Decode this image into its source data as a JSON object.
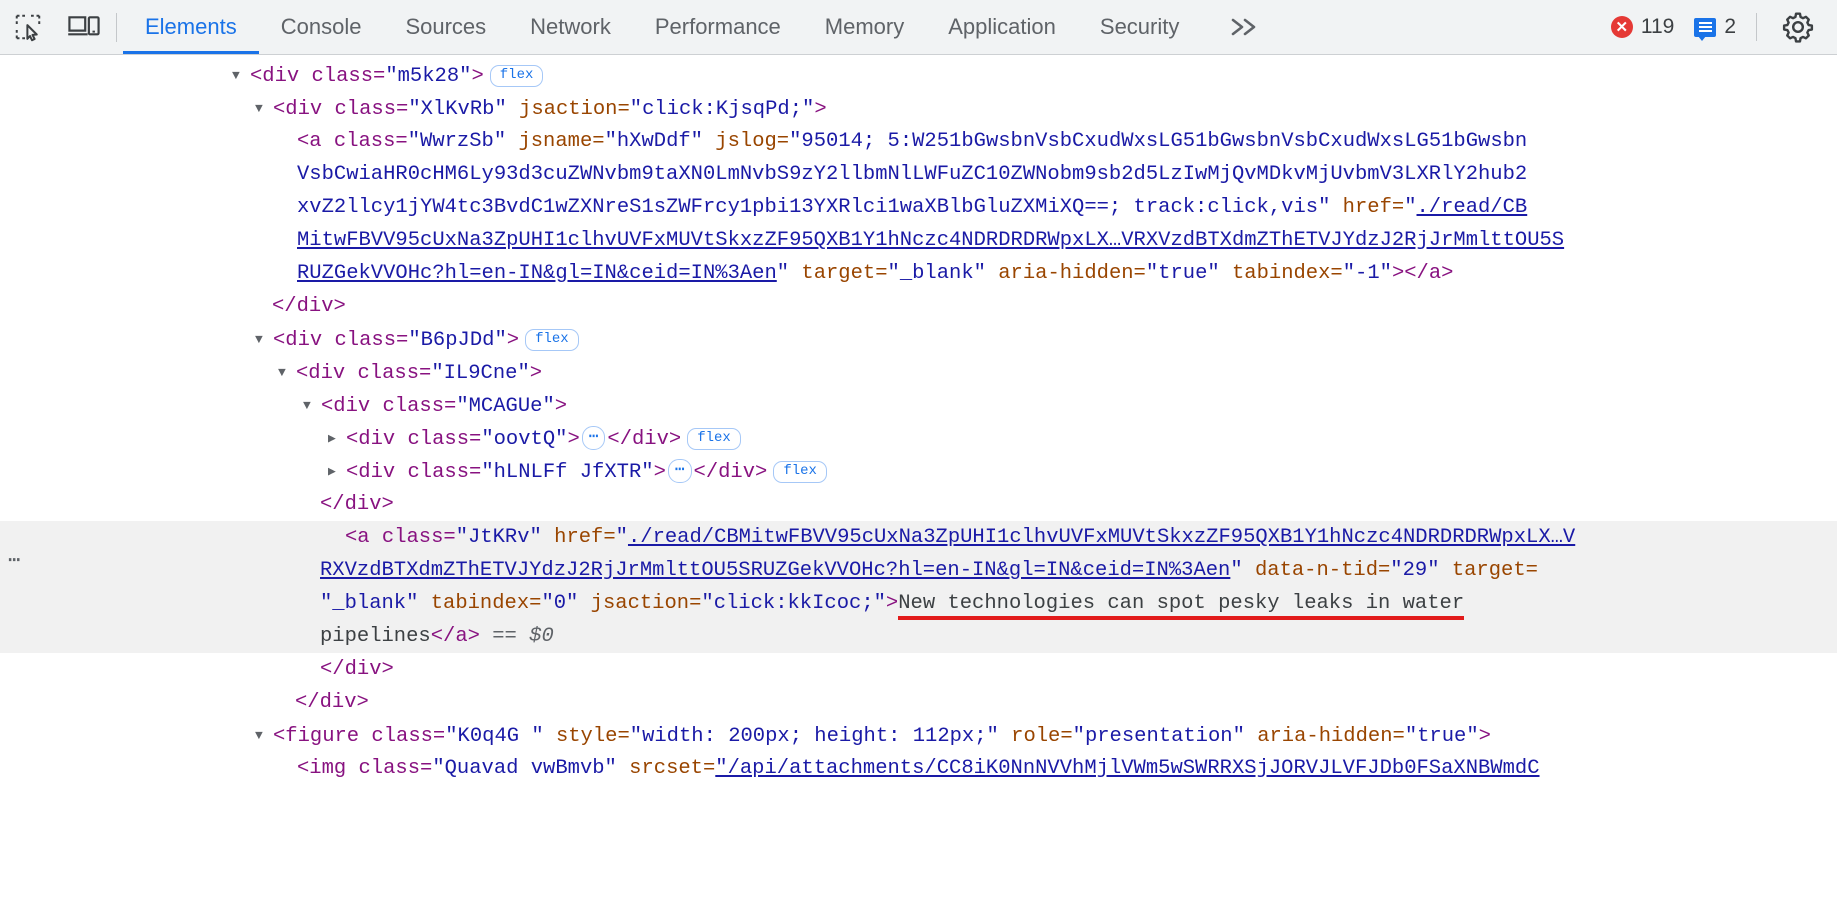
{
  "toolbar": {
    "inspect_icon": "inspect-element-icon",
    "device_icon": "device-toolbar-icon",
    "tabs": [
      {
        "label": "Elements",
        "active": true
      },
      {
        "label": "Console",
        "active": false
      },
      {
        "label": "Sources",
        "active": false
      },
      {
        "label": "Network",
        "active": false
      },
      {
        "label": "Performance",
        "active": false
      },
      {
        "label": "Memory",
        "active": false
      },
      {
        "label": "Application",
        "active": false
      },
      {
        "label": "Security",
        "active": false
      }
    ],
    "more_tabs": "»",
    "errors": {
      "count": "119",
      "icon": "error-circle-icon",
      "color": "#e53935"
    },
    "messages": {
      "count": "2",
      "icon": "message-icon",
      "color": "#1a73e8"
    },
    "settings_icon": "gear-icon"
  },
  "dom": {
    "line1": {
      "tag_open": "<div class=",
      "cls": "\"m5k28\"",
      "close": ">",
      "badge": "flex"
    },
    "line2": {
      "a": "<div class=",
      "cls": "\"XlKvRb\"",
      "b": " jsaction=",
      "jsaction": "\"click:KjsqPd;\"",
      "c": ">"
    },
    "line3": {
      "a": "<a class=",
      "cls": "\"WwrzSb\"",
      "b": " jsname=",
      "jsname": "\"hXwDdf\"",
      "c": " jslog=",
      "jslog_1": "\"95014; 5:W251bGwsbnVsbCxudWxsLG51bGwsbnVsbCxudWxsLG51bGwsbn",
      "jslog_2": "VsbCwiaHR0cHM6Ly93d3cuZWNvbm9taXN0LmNvbS9zY2llbmNlLWFuZC10ZWNobm9sb2d5LzIwMjQvMDkvMjUvbmV3LXRlY2hub2",
      "jslog_3": "xvZ2llcy1jYW4tc3BvdC1wZXNreS1sZWFrcy1pbi13YXRlci1waXBlbGluZXMiXQ==; track:click,vis\"",
      "href_label": " href=",
      "href_q": "\"",
      "href_1": "./read/CB",
      "href_2": "MitwFBVV95cUxNa3ZpUHI1clhvUVFxMUVtSkxzZF95QXB1Y1hNczc4NDRDRDRWpxLX…VRXVzdBTXdmZThETVJYdzJ2RjJrMmlttOU5S",
      "href_3": "RUZGekVVOHc?hl=en-IN&gl=IN&ceid=IN%3Aen",
      "href_q2": "\"",
      "target": " target=",
      "target_val": "\"_blank\"",
      "aria": " aria-hidden=",
      "aria_val": "\"true\"",
      "tabindex": " tabindex=",
      "tabindex_val": "\"-1\"",
      "end": "></a>"
    },
    "line4": "</div>",
    "line5": {
      "a": "<div class=",
      "cls": "\"B6pJDd\"",
      "c": ">",
      "badge": "flex"
    },
    "line6": {
      "a": "<div class=",
      "cls": "\"IL9Cne\"",
      "c": ">"
    },
    "line7": {
      "a": "<div class=",
      "cls": "\"MCAGUe\"",
      "c": ">"
    },
    "line8": {
      "a": "<div class=",
      "cls": "\"oovtQ\"",
      "c": ">",
      "ellipsis": "…",
      "close": "</div>",
      "badge": "flex"
    },
    "line9": {
      "a": "<div class=",
      "cls": "\"hLNLFf JfXTR\"",
      "c": ">",
      "ellipsis": "…",
      "close": "</div>",
      "badge": "flex"
    },
    "line10": "</div>",
    "selected": {
      "gutter": "…",
      "a": "<a class=",
      "cls": "\"JtKRv\"",
      "b": " href=",
      "href_q": "\"",
      "href_1": "./read/CBMitwFBVV95cUxNa3ZpUHI1clhvUVFxMUVtSkxzZF95QXB1Y1hNczc4NDRDRDRWpxLX…V",
      "href_2": "RXVzdBTXdmZThETVJYdzJ2RjJrMmlttOU5SRUZGekVVOHc?hl=en-IN&gl=IN&ceid=IN%3Aen",
      "href_q2": "\"",
      "dntid": " data-n-tid=",
      "dntid_val": "\"29\"",
      "target": " target=",
      "target_val": "\"_blank\"",
      "tabindex": " tabindex=",
      "tabindex_val": "\"0\"",
      "jsaction": " jsaction=",
      "jsaction_val": "\"click:kkIcoc;\"",
      "gt": ">",
      "text_1": "New technologies can spot pesky leaks in water",
      "text_2": "pipelines",
      "close_tag": "</a>",
      "selector": "== $0"
    },
    "line_close1": "</div>",
    "line_close2": "</div>",
    "figure": {
      "a": "<figure class=",
      "cls": "\"K0q4G \"",
      "b": " style=",
      "style_val": "\"width: 200px; height: 112px;\"",
      "c": " role=",
      "role_val": "\"presentation\"",
      "d": " aria-hidden=",
      "aria_val": "\"true\"",
      "e": ">"
    },
    "img": {
      "a": "<img class=",
      "cls": "\"Quavad vwBmvb\"",
      "b": " srcset=",
      "srcset_val": "\"/api/attachments/CC8iK0NnNVVhMjlVWm5wSWRRXSjJORVJLVFJDb0FSaXNBWmdC"
    }
  }
}
